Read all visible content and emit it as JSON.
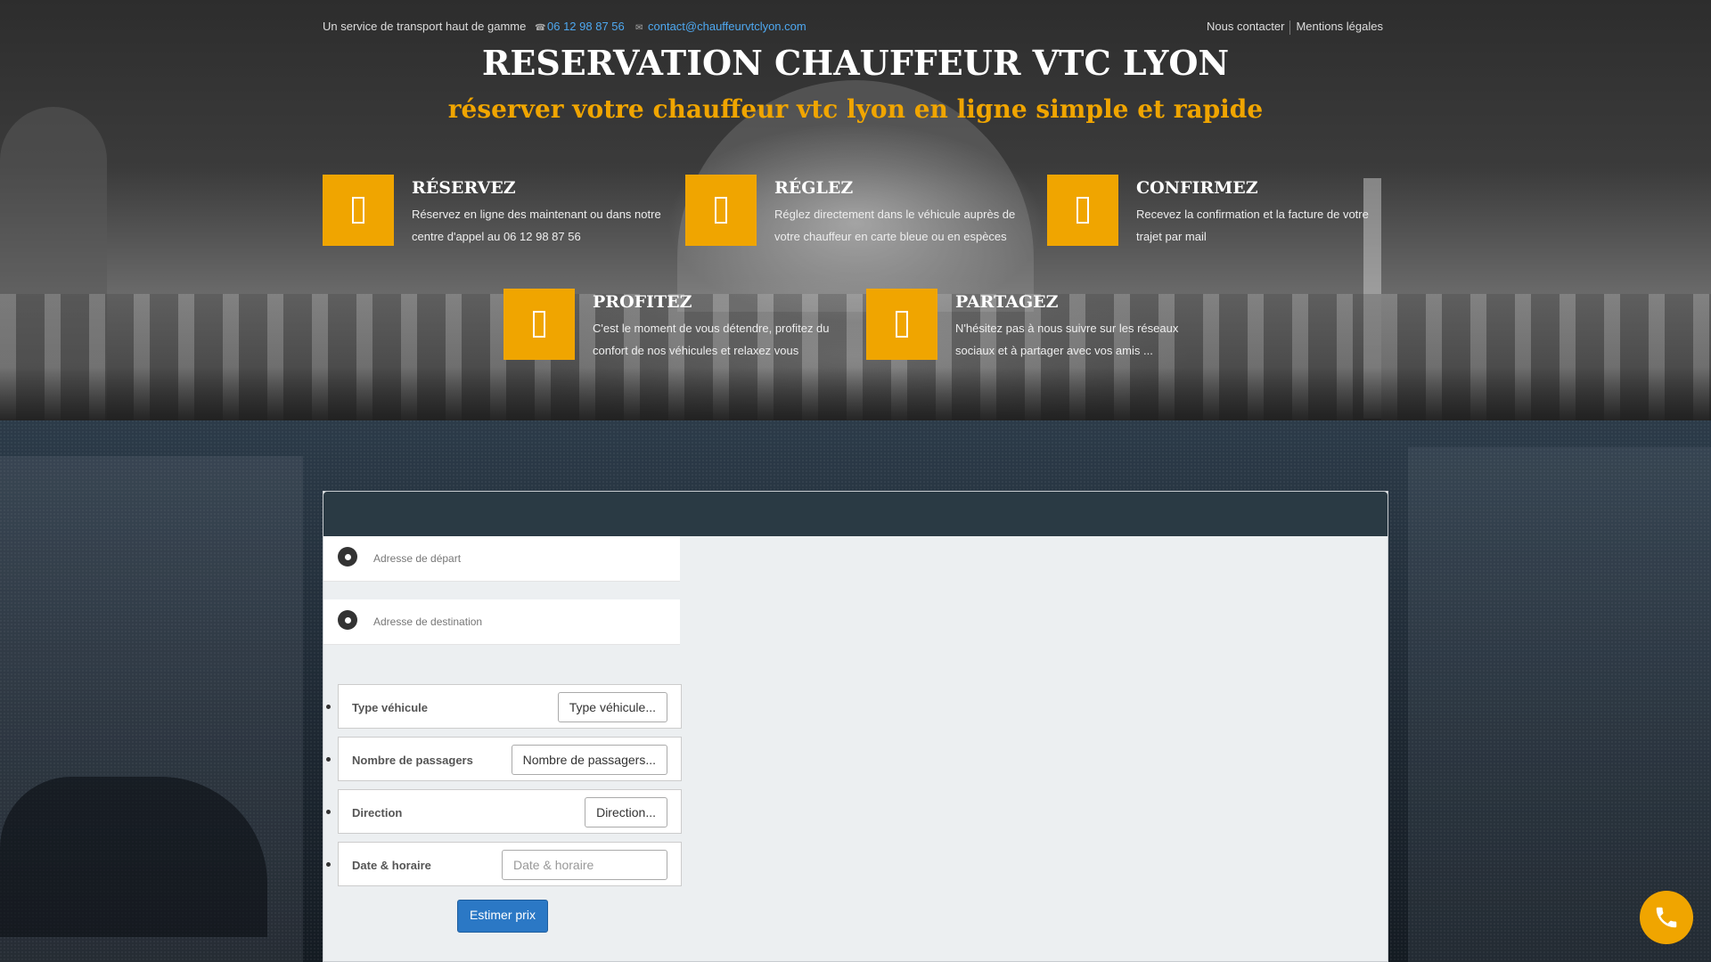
{
  "topbar": {
    "tagline": "Un service de transport haut de gamme",
    "phone": "06 12 98 87 56",
    "email": "contact@chauffeurvtclyon.com",
    "nav": [
      "Nous contacter",
      "Mentions légales"
    ]
  },
  "hero": {
    "title": "RESERVATION CHAUFFEUR VTC LYON",
    "subtitle": "réserver votre chauffeur vtc lyon en ligne simple et rapide"
  },
  "features": [
    {
      "title": "RÉSERVEZ",
      "desc": "Réservez en ligne des maintenant ou dans notre centre d'appel au 06 12 98 87 56"
    },
    {
      "title": "RÉGLEZ",
      "desc": "Réglez directement dans le véhicule auprès de votre chauffeur en carte bleue ou en espèces"
    },
    {
      "title": "CONFIRMEZ",
      "desc": "Recevez la confirmation et la facture de votre trajet par mail"
    },
    {
      "title": "PROFITEZ",
      "desc": "C'est le moment de vous détendre, profitez du confort de nos véhicules et relaxez vous"
    },
    {
      "title": "PARTAGEZ",
      "desc": "N'hésitez pas à nous suivre sur les réseaux sociaux et à partager avec vos amis ..."
    }
  ],
  "form": {
    "departure_placeholder": "Adresse de départ",
    "destination_placeholder": "Adresse de destination",
    "options": [
      {
        "label": "Type véhicule",
        "value": "Type véhicule..."
      },
      {
        "label": "Nombre de passagers",
        "value": "Nombre de passagers..."
      },
      {
        "label": "Direction",
        "value": "Direction..."
      },
      {
        "label": "Date & horaire",
        "value": "Date & horaire"
      }
    ],
    "estimate_label": "Estimer prix"
  },
  "colors": {
    "accent": "#f0a500",
    "link": "#4ea8f0",
    "button": "#2b78c5",
    "panel_header": "#2a3a44"
  },
  "icons": {
    "feature": "feature-icon",
    "pin": "map-pin-icon",
    "call": "phone-icon"
  }
}
